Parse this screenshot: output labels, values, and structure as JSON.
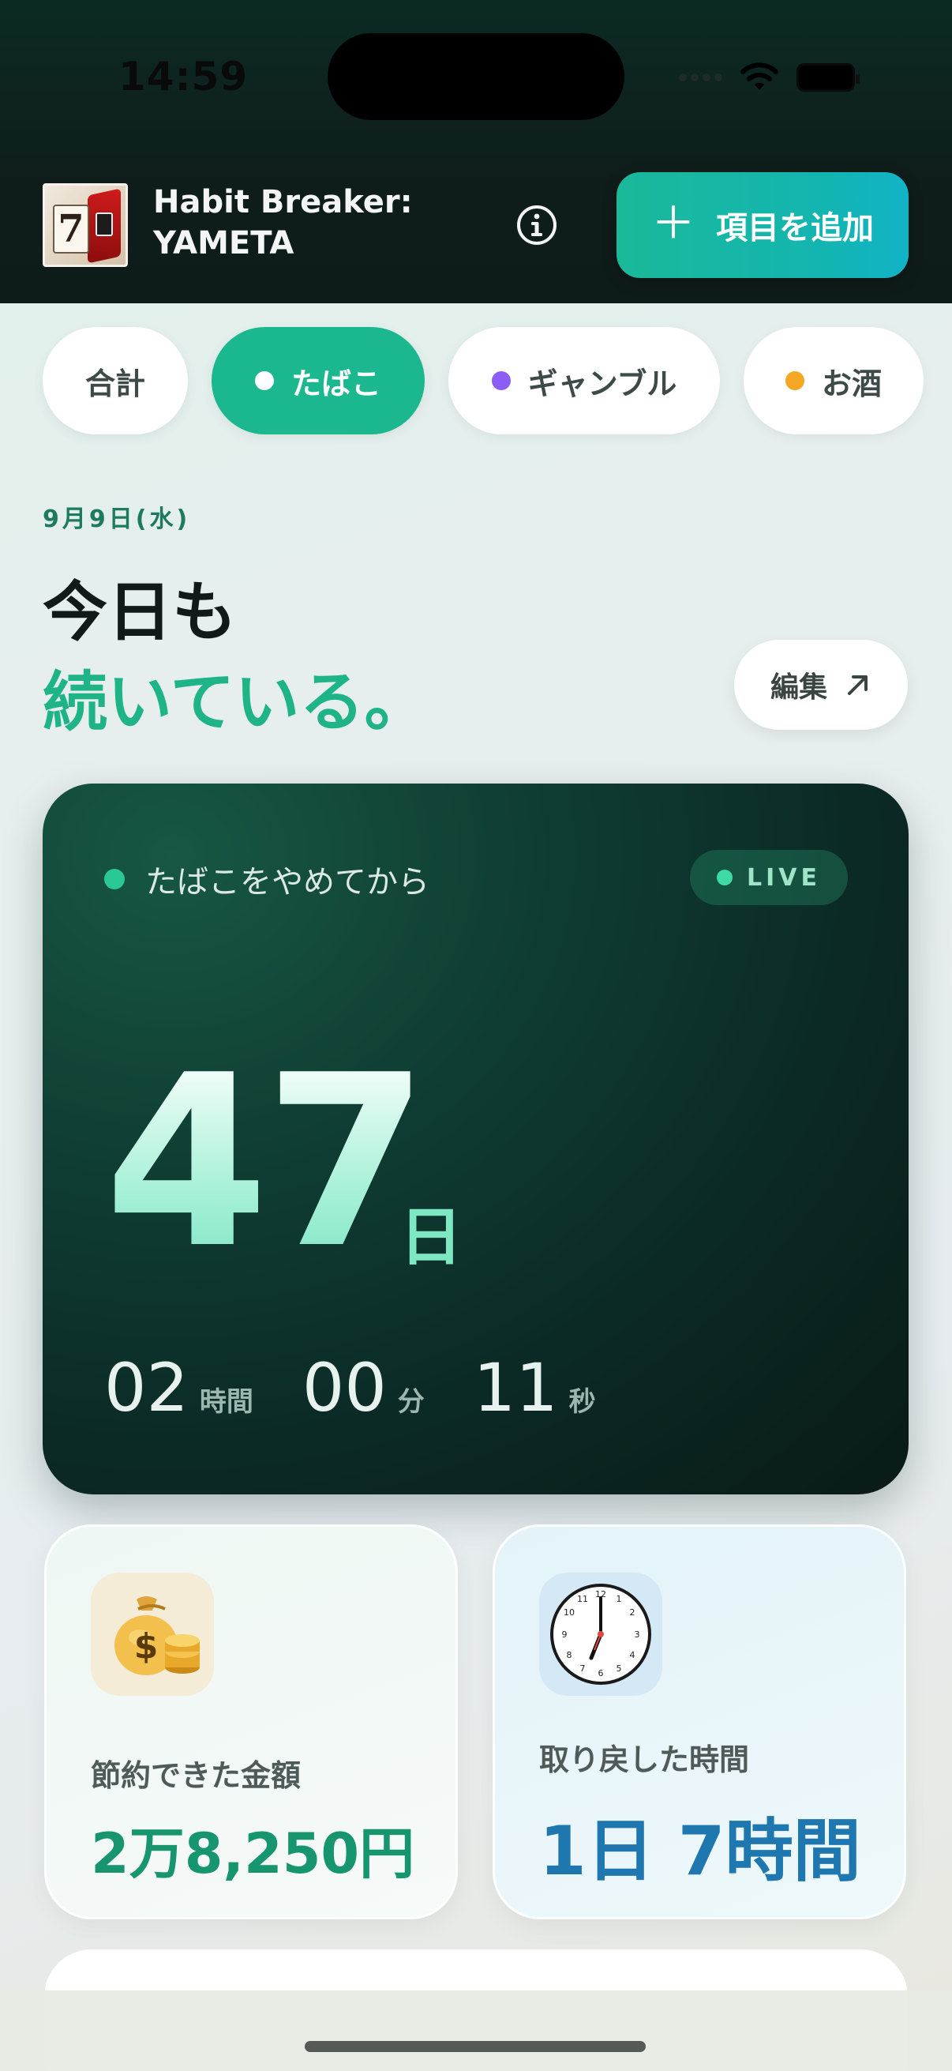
{
  "status_bar": {
    "time": "14:59"
  },
  "header": {
    "app_title": "Habit Breaker:\nYAMETA",
    "add_button_label": "項目を追加"
  },
  "filters": [
    {
      "label": "合計",
      "active": false
    },
    {
      "label": "たばこ",
      "active": true,
      "dot_color": "#ffffff"
    },
    {
      "label": "ギャンブル",
      "active": false,
      "dot_color": "#8b5cf6"
    },
    {
      "label": "お酒",
      "active": false,
      "dot_color": "#f5a623"
    }
  ],
  "greeting": {
    "date": "9月9日(水)",
    "line1": "今日も",
    "line2": "続いている。",
    "edit_label": "編集"
  },
  "counter": {
    "label": "たばこをやめてから",
    "live": "LIVE",
    "days": "47",
    "days_unit": "日",
    "hours": "02",
    "hours_unit": "時間",
    "minutes": "00",
    "minutes_unit": "分",
    "seconds": "11",
    "seconds_unit": "秒"
  },
  "stats": {
    "money": {
      "label": "節約できた金額",
      "value": "2万8,250円",
      "icon": "money-bag-icon"
    },
    "time": {
      "label": "取り戻した時間",
      "value": "1日 7時間",
      "icon": "clock-icon"
    }
  },
  "colors": {
    "accent": "#1bb78f",
    "header_bg": "#0f1d1a",
    "time_value": "#1f77b0"
  }
}
